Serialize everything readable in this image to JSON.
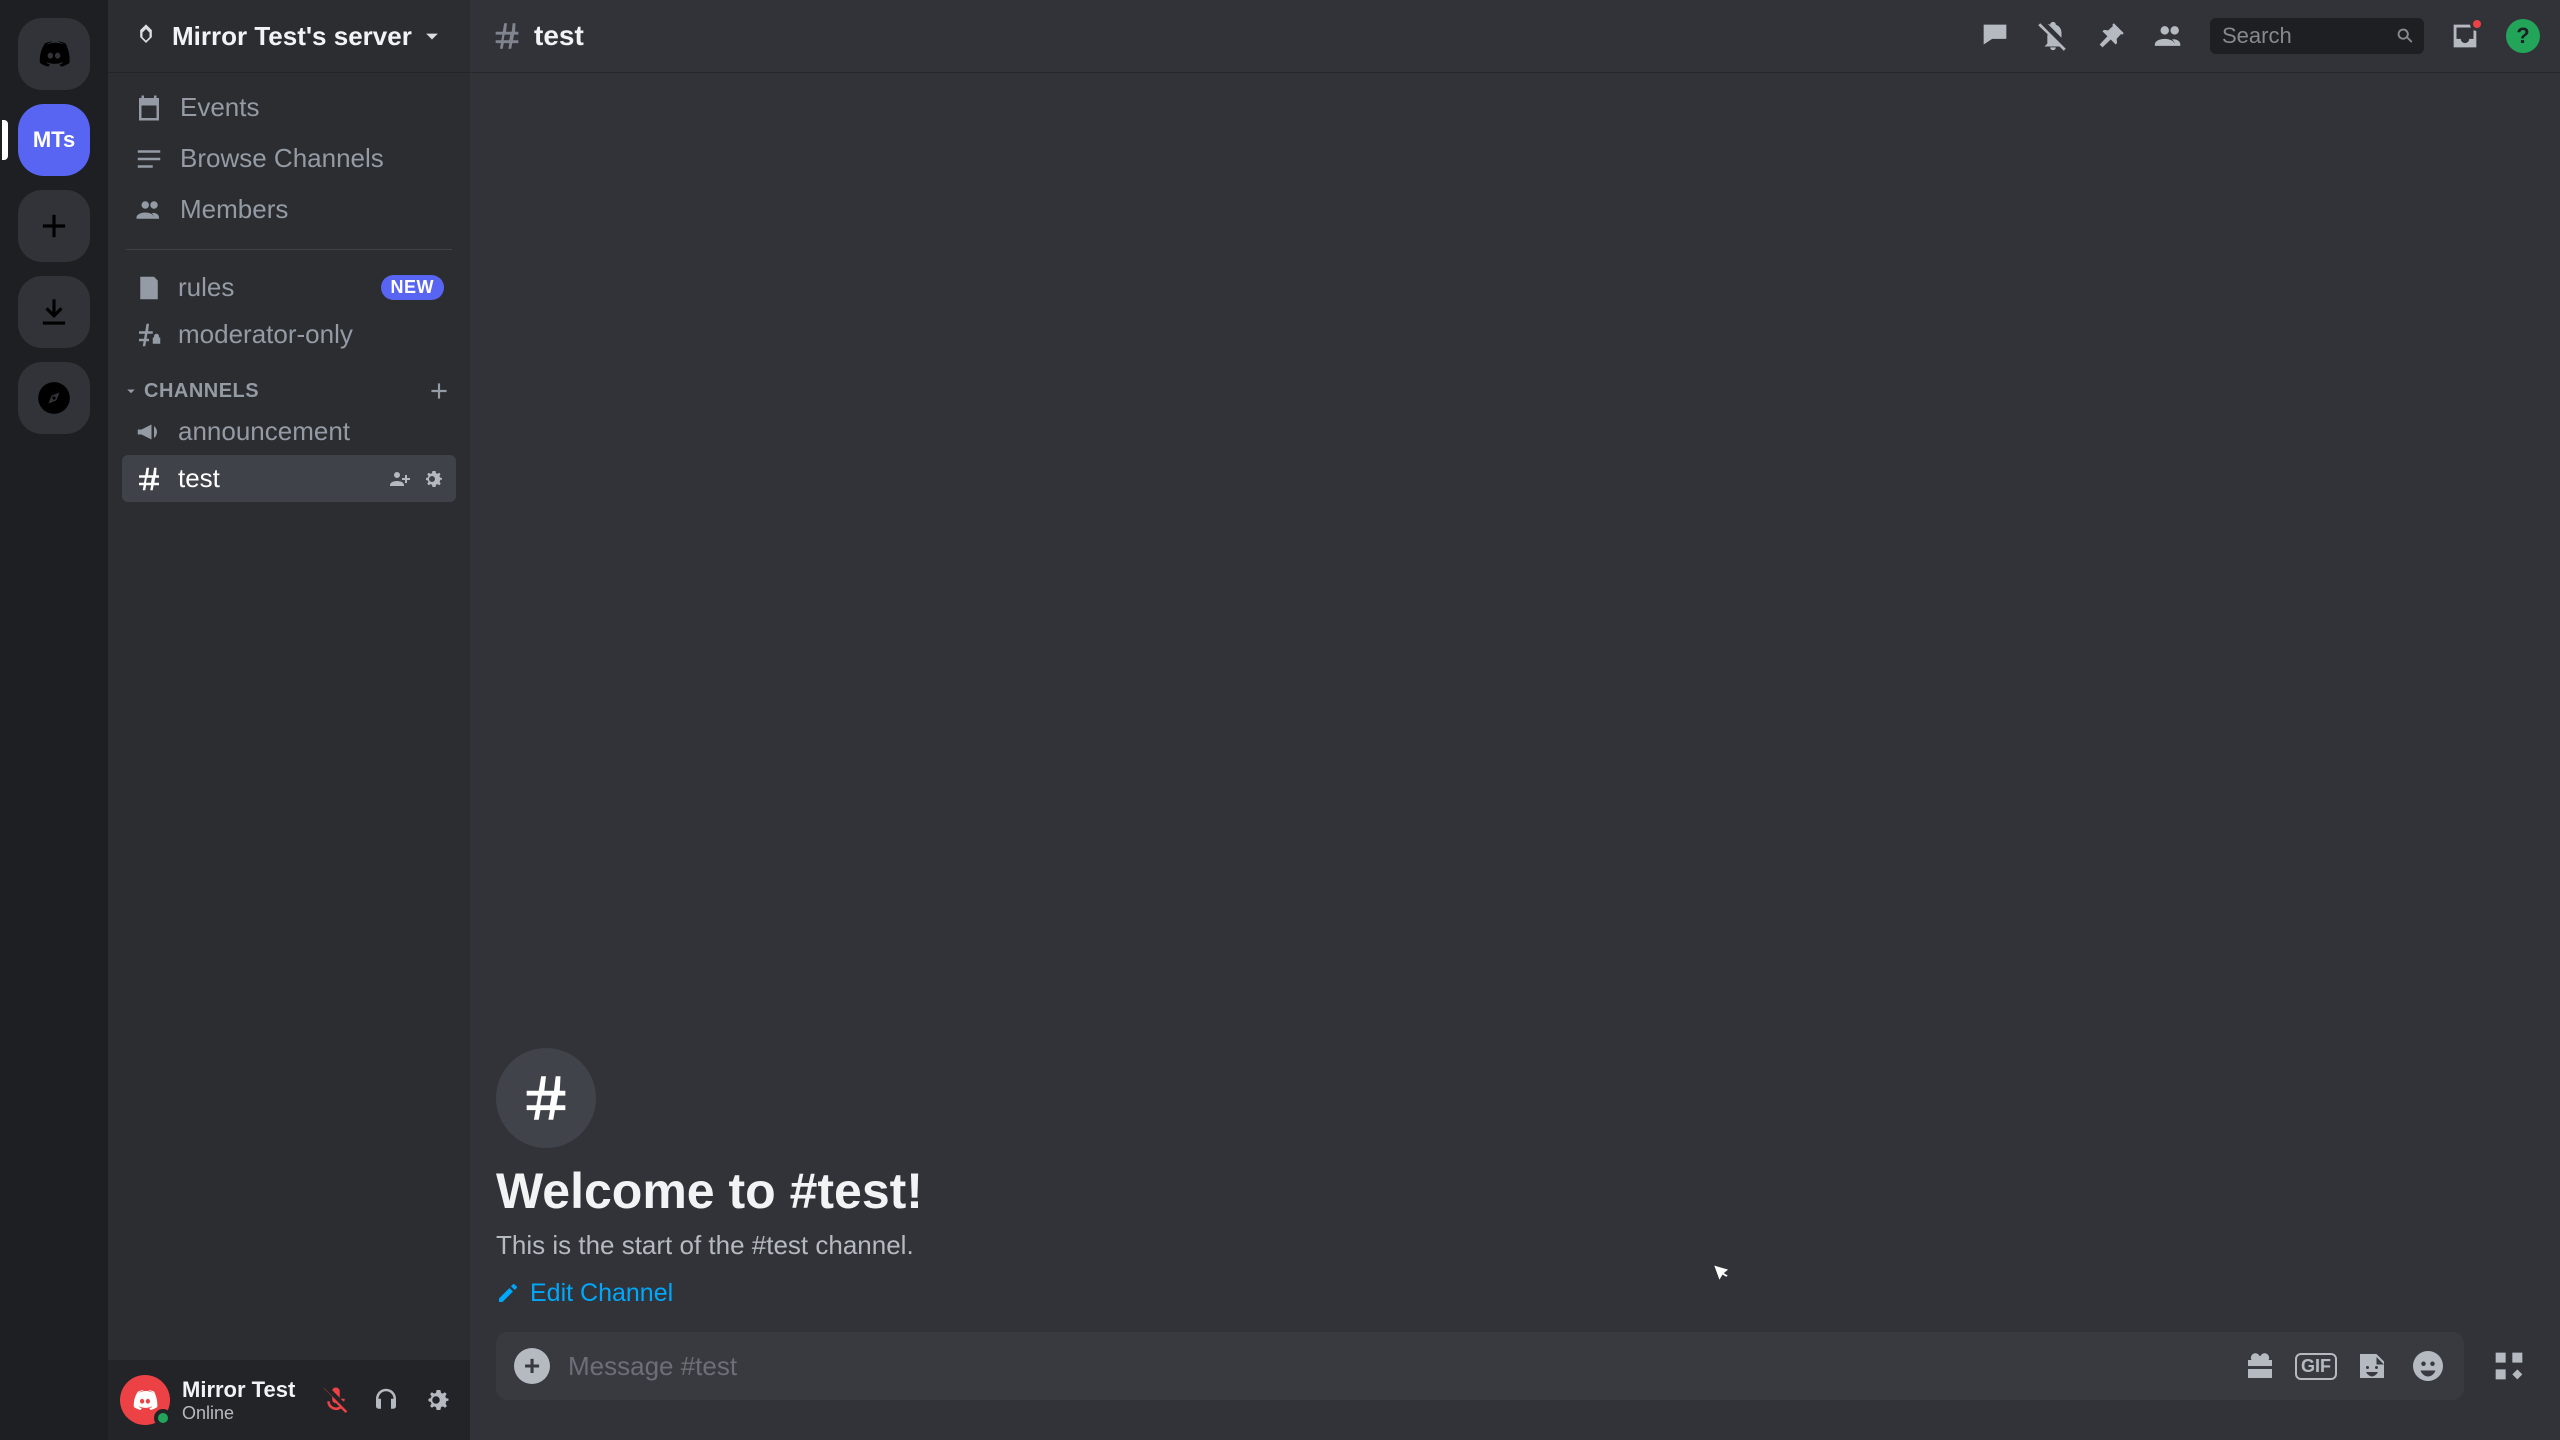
{
  "guild_rail": {
    "dm_tooltip": "Direct Messages",
    "active_server_initials": "MTs",
    "add_server_tooltip": "Add a Server",
    "download_tooltip": "Download Apps",
    "explore_tooltip": "Explore Discoverable Servers"
  },
  "server": {
    "name": "Mirror Test's server",
    "nav": {
      "events": "Events",
      "browse": "Browse Channels",
      "members": "Members"
    },
    "special_channels": [
      {
        "id": "rules",
        "label": "rules",
        "badge": "NEW",
        "type": "rules"
      },
      {
        "id": "moderator-only",
        "label": "moderator-only",
        "type": "locked-text"
      }
    ],
    "categories": [
      {
        "label": "CHANNELS",
        "channels": [
          {
            "id": "announcement",
            "label": "announcement",
            "type": "announcement",
            "selected": false
          },
          {
            "id": "test",
            "label": "test",
            "type": "text",
            "selected": true
          }
        ]
      }
    ]
  },
  "user": {
    "display_name": "Mirror Test",
    "status": "Online",
    "muted": true
  },
  "chat_header": {
    "channel_name": "test",
    "search_placeholder": "Search",
    "icons": [
      "threads",
      "notifications-muted",
      "pinned",
      "members",
      "inbox",
      "help"
    ]
  },
  "welcome": {
    "title": "Welcome to #test!",
    "subtitle": "This is the start of the #test channel.",
    "edit_label": "Edit Channel"
  },
  "composer": {
    "placeholder": "Message #test",
    "icons": [
      "gift",
      "gif",
      "sticker",
      "emoji"
    ],
    "apps_tooltip": "Apps"
  },
  "colors": {
    "blurple": "#5865f2",
    "green": "#23a559",
    "red": "#ed4245",
    "link": "#00a8fc"
  }
}
